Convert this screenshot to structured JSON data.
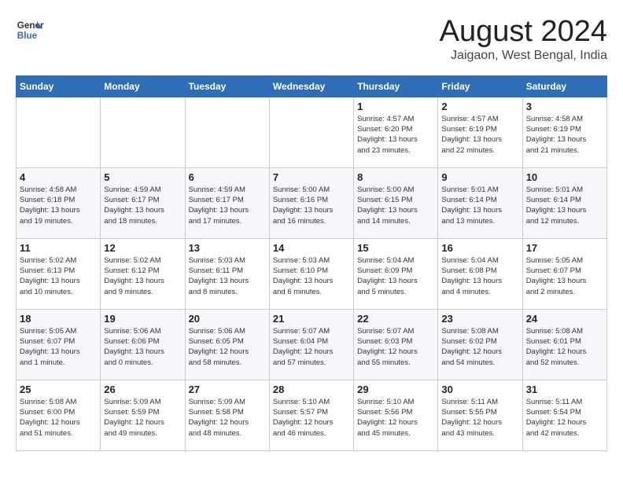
{
  "header": {
    "logo_line1": "General",
    "logo_line2": "Blue",
    "month_title": "August 2024",
    "location": "Jaigaon, West Bengal, India"
  },
  "weekdays": [
    "Sunday",
    "Monday",
    "Tuesday",
    "Wednesday",
    "Thursday",
    "Friday",
    "Saturday"
  ],
  "weeks": [
    [
      {
        "day": "",
        "text": ""
      },
      {
        "day": "",
        "text": ""
      },
      {
        "day": "",
        "text": ""
      },
      {
        "day": "",
        "text": ""
      },
      {
        "day": "1",
        "text": "Sunrise: 4:57 AM\nSunset: 6:20 PM\nDaylight: 13 hours\nand 23 minutes."
      },
      {
        "day": "2",
        "text": "Sunrise: 4:57 AM\nSunset: 6:19 PM\nDaylight: 13 hours\nand 22 minutes."
      },
      {
        "day": "3",
        "text": "Sunrise: 4:58 AM\nSunset: 6:19 PM\nDaylight: 13 hours\nand 21 minutes."
      }
    ],
    [
      {
        "day": "4",
        "text": "Sunrise: 4:58 AM\nSunset: 6:18 PM\nDaylight: 13 hours\nand 19 minutes."
      },
      {
        "day": "5",
        "text": "Sunrise: 4:59 AM\nSunset: 6:17 PM\nDaylight: 13 hours\nand 18 minutes."
      },
      {
        "day": "6",
        "text": "Sunrise: 4:59 AM\nSunset: 6:17 PM\nDaylight: 13 hours\nand 17 minutes."
      },
      {
        "day": "7",
        "text": "Sunrise: 5:00 AM\nSunset: 6:16 PM\nDaylight: 13 hours\nand 16 minutes."
      },
      {
        "day": "8",
        "text": "Sunrise: 5:00 AM\nSunset: 6:15 PM\nDaylight: 13 hours\nand 14 minutes."
      },
      {
        "day": "9",
        "text": "Sunrise: 5:01 AM\nSunset: 6:14 PM\nDaylight: 13 hours\nand 13 minutes."
      },
      {
        "day": "10",
        "text": "Sunrise: 5:01 AM\nSunset: 6:14 PM\nDaylight: 13 hours\nand 12 minutes."
      }
    ],
    [
      {
        "day": "11",
        "text": "Sunrise: 5:02 AM\nSunset: 6:13 PM\nDaylight: 13 hours\nand 10 minutes."
      },
      {
        "day": "12",
        "text": "Sunrise: 5:02 AM\nSunset: 6:12 PM\nDaylight: 13 hours\nand 9 minutes."
      },
      {
        "day": "13",
        "text": "Sunrise: 5:03 AM\nSunset: 6:11 PM\nDaylight: 13 hours\nand 8 minutes."
      },
      {
        "day": "14",
        "text": "Sunrise: 5:03 AM\nSunset: 6:10 PM\nDaylight: 13 hours\nand 6 minutes."
      },
      {
        "day": "15",
        "text": "Sunrise: 5:04 AM\nSunset: 6:09 PM\nDaylight: 13 hours\nand 5 minutes."
      },
      {
        "day": "16",
        "text": "Sunrise: 5:04 AM\nSunset: 6:08 PM\nDaylight: 13 hours\nand 4 minutes."
      },
      {
        "day": "17",
        "text": "Sunrise: 5:05 AM\nSunset: 6:07 PM\nDaylight: 13 hours\nand 2 minutes."
      }
    ],
    [
      {
        "day": "18",
        "text": "Sunrise: 5:05 AM\nSunset: 6:07 PM\nDaylight: 13 hours\nand 1 minute."
      },
      {
        "day": "19",
        "text": "Sunrise: 5:06 AM\nSunset: 6:06 PM\nDaylight: 13 hours\nand 0 minutes."
      },
      {
        "day": "20",
        "text": "Sunrise: 5:06 AM\nSunset: 6:05 PM\nDaylight: 12 hours\nand 58 minutes."
      },
      {
        "day": "21",
        "text": "Sunrise: 5:07 AM\nSunset: 6:04 PM\nDaylight: 12 hours\nand 57 minutes."
      },
      {
        "day": "22",
        "text": "Sunrise: 5:07 AM\nSunset: 6:03 PM\nDaylight: 12 hours\nand 55 minutes."
      },
      {
        "day": "23",
        "text": "Sunrise: 5:08 AM\nSunset: 6:02 PM\nDaylight: 12 hours\nand 54 minutes."
      },
      {
        "day": "24",
        "text": "Sunrise: 5:08 AM\nSunset: 6:01 PM\nDaylight: 12 hours\nand 52 minutes."
      }
    ],
    [
      {
        "day": "25",
        "text": "Sunrise: 5:08 AM\nSunset: 6:00 PM\nDaylight: 12 hours\nand 51 minutes."
      },
      {
        "day": "26",
        "text": "Sunrise: 5:09 AM\nSunset: 5:59 PM\nDaylight: 12 hours\nand 49 minutes."
      },
      {
        "day": "27",
        "text": "Sunrise: 5:09 AM\nSunset: 5:58 PM\nDaylight: 12 hours\nand 48 minutes."
      },
      {
        "day": "28",
        "text": "Sunrise: 5:10 AM\nSunset: 5:57 PM\nDaylight: 12 hours\nand 46 minutes."
      },
      {
        "day": "29",
        "text": "Sunrise: 5:10 AM\nSunset: 5:56 PM\nDaylight: 12 hours\nand 45 minutes."
      },
      {
        "day": "30",
        "text": "Sunrise: 5:11 AM\nSunset: 5:55 PM\nDaylight: 12 hours\nand 43 minutes."
      },
      {
        "day": "31",
        "text": "Sunrise: 5:11 AM\nSunset: 5:54 PM\nDaylight: 12 hours\nand 42 minutes."
      }
    ]
  ]
}
